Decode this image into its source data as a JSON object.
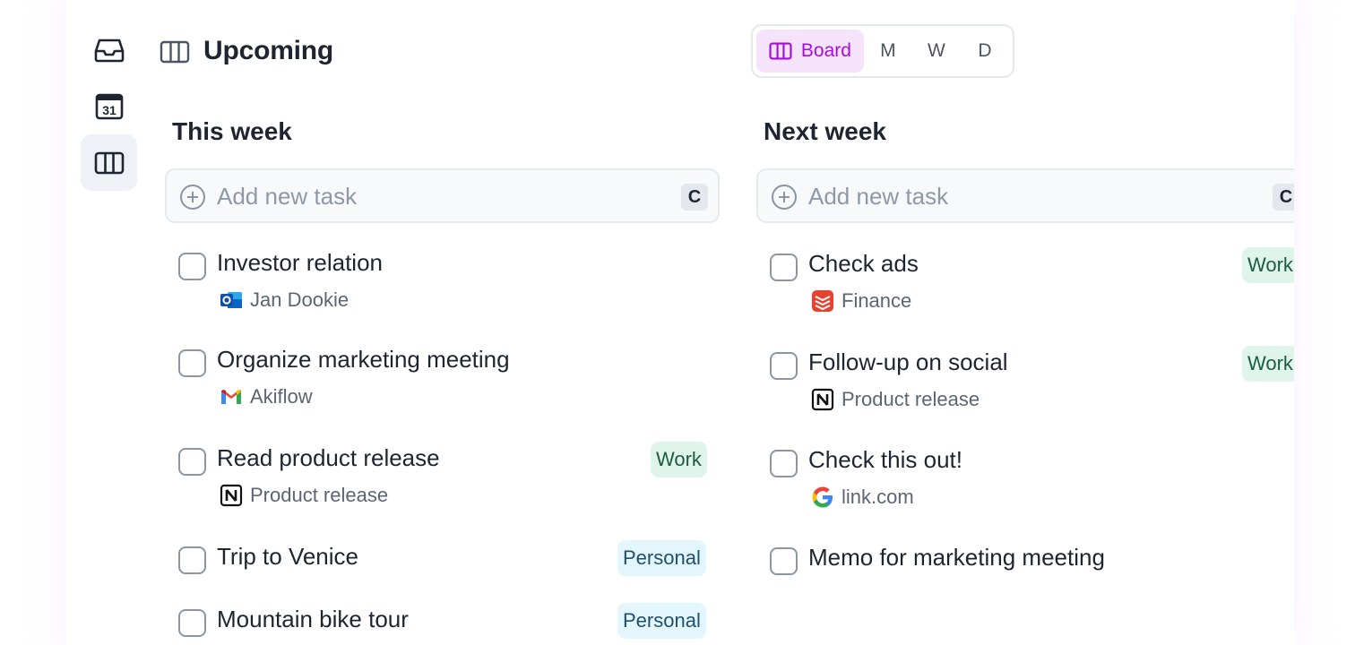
{
  "sidebar": {
    "items": [
      {
        "icon": "inbox-icon",
        "label": ""
      },
      {
        "icon": "calendar-icon",
        "label": "31"
      },
      {
        "icon": "board-icon",
        "label": "",
        "active": true
      }
    ]
  },
  "header": {
    "icon": "board-icon",
    "title": "Upcoming"
  },
  "view_toggle": {
    "board": "Board",
    "options": [
      "M",
      "W",
      "D"
    ],
    "active_color": "#a40fd8"
  },
  "columns": [
    {
      "title": "This week",
      "add_placeholder": "Add new task",
      "shortcut": "C",
      "tasks": [
        {
          "title": "Investor relation",
          "source_icon": "outlook-icon",
          "source": "Jan Dookie",
          "tag": ""
        },
        {
          "title": "Organize marketing meeting",
          "source_icon": "gmail-icon",
          "source": "Akiflow",
          "tag": ""
        },
        {
          "title": "Read product release",
          "source_icon": "notion-icon",
          "source": "Product release",
          "tag": "Work"
        },
        {
          "title": "Trip to Venice",
          "source_icon": "",
          "source": "",
          "tag": "Personal"
        },
        {
          "title": "Mountain bike tour",
          "source_icon": "",
          "source": "",
          "tag": "Personal"
        }
      ]
    },
    {
      "title": "Next week",
      "add_placeholder": "Add new task",
      "shortcut": "C",
      "tasks": [
        {
          "title": "Check ads",
          "source_icon": "todoist-icon",
          "source": "Finance",
          "tag": "Work"
        },
        {
          "title": "Follow-up on social",
          "source_icon": "notion-icon",
          "source": "Product release",
          "tag": "Work"
        },
        {
          "title": "Check this out!",
          "source_icon": "google-icon",
          "source": "link.com",
          "tag": ""
        },
        {
          "title": "Memo for marketing meeting",
          "source_icon": "",
          "source": "",
          "tag": ""
        }
      ]
    }
  ],
  "colors": {
    "work_tag_bg": "#dff5ec",
    "personal_tag_bg": "#e3f5fd",
    "board_active_bg": "#f5e3fb"
  }
}
